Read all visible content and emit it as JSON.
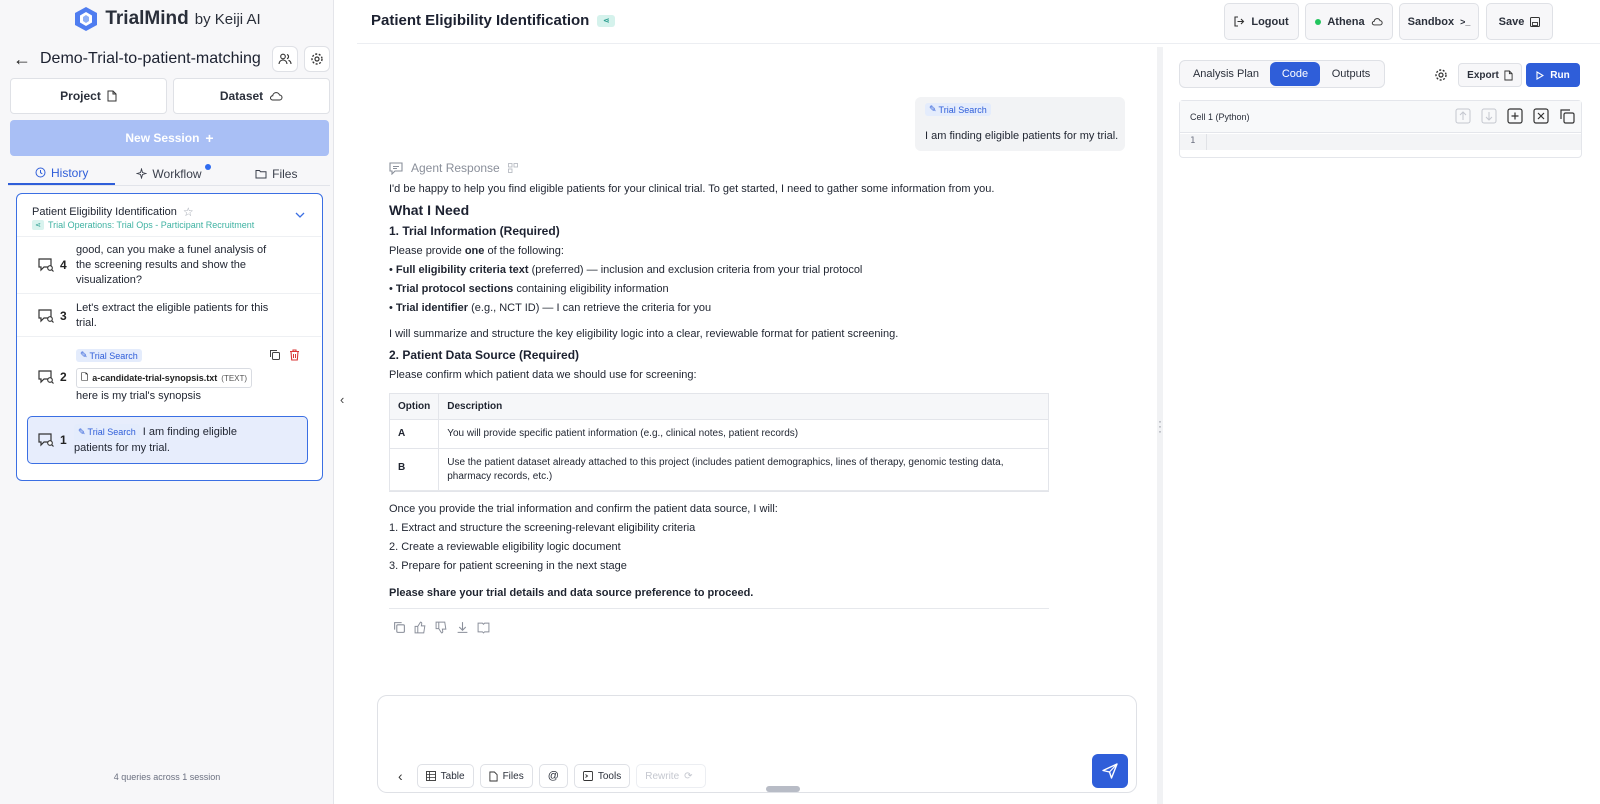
{
  "brand": {
    "name": "TrialMind",
    "by": "by Keiji AI"
  },
  "project": {
    "title": "Demo-Trial-to-patient-matching"
  },
  "sidebar": {
    "project_label": "Project",
    "dataset_label": "Dataset",
    "new_session_label": "New Session",
    "tabs": [
      {
        "label": "History",
        "active": true
      },
      {
        "label": "Workflow",
        "active": false
      },
      {
        "label": "Files",
        "active": false
      }
    ],
    "session": {
      "title": "Patient Eligibility Identification",
      "subtitle": "Trial Operations: Trial Ops - Participant Recruitment",
      "queries": [
        {
          "num": "4",
          "text": "good, can you make a funel analysis of the screening results and show the visualization?"
        },
        {
          "num": "3",
          "text": "Let's extract the eligible patients for this trial."
        },
        {
          "num": "2",
          "tag": "Trial Search",
          "file": "a-candidate-trial-synopsis.txt",
          "file_type": "(TEXT)",
          "text": "here is my trial's synopsis"
        },
        {
          "num": "1",
          "tag": "Trial Search",
          "text": "I am finding eligible patients for my trial."
        }
      ]
    },
    "footer": "4 queries across 1 session"
  },
  "header": {
    "title": "Patient Eligibility Identification",
    "logout_label": "Logout",
    "athena_label": "Athena",
    "sandbox_label": "Sandbox",
    "save_label": "Save"
  },
  "chat": {
    "user_message": {
      "tag": "Trial Search",
      "text": "I am finding eligible patients for my trial."
    },
    "agent_label": "Agent Response",
    "response": {
      "intro": "I'd be happy to help you find eligible patients for your clinical trial. To get started, I need to gather some information from you.",
      "h_need": "What I Need",
      "h_trial": "1. Trial Information (Required)",
      "provide_pre": "Please provide ",
      "provide_bold": "one",
      "provide_post": " of the following:",
      "bullets": [
        {
          "bold": "Full eligibility criteria text",
          "rest": " (preferred) — inclusion and exclusion criteria from your trial protocol"
        },
        {
          "bold": "Trial protocol sections",
          "rest": " containing eligibility information"
        },
        {
          "bold": "Trial identifier",
          "rest": " (e.g., NCT ID) — I can retrieve the criteria for you"
        }
      ],
      "summarize": "I will summarize and structure the key eligibility logic into a clear, reviewable format for patient screening.",
      "h_data": "2. Patient Data Source (Required)",
      "confirm": "Please confirm which patient data we should use for screening:",
      "table": {
        "headers": [
          "Option",
          "Description"
        ],
        "rows": [
          [
            "A",
            "You will provide specific patient information (e.g., clinical notes, patient records)"
          ],
          [
            "B",
            "Use the patient dataset already attached to this project (includes patient demographics, lines of therapy, genomic testing data, pharmacy records, etc.)"
          ]
        ]
      },
      "once": "Once you provide the trial information and confirm the patient data source, I will:",
      "steps": [
        "1. Extract and structure the screening-relevant eligibility criteria",
        "2. Create a reviewable eligibility logic document",
        "3. Prepare for patient screening in the next stage"
      ],
      "closing": "Please share your trial details and data source preference to proceed."
    },
    "composer": {
      "tools": [
        "Table",
        "Files",
        "@",
        "Tools",
        "Rewrite"
      ]
    }
  },
  "right_pane": {
    "tabs": [
      {
        "label": "Analysis Plan",
        "active": false
      },
      {
        "label": "Code",
        "active": true
      },
      {
        "label": "Outputs",
        "active": false
      }
    ],
    "export_label": "Export",
    "run_label": "Run",
    "cell_title": "Cell 1 (Python)",
    "line_number": "1"
  },
  "colors": {
    "accent": "#2f5ed9",
    "tag_bg": "#e4ecfc",
    "teal": "#3fb2a2",
    "online": "#22c55e"
  }
}
